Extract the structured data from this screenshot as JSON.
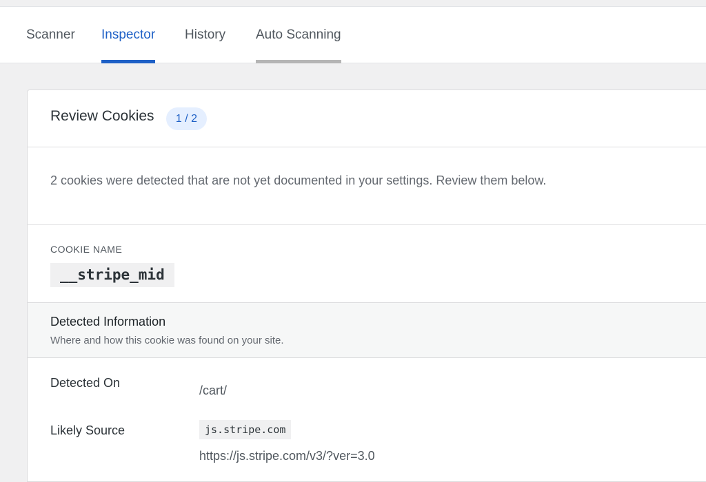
{
  "tabs": [
    {
      "label": "Scanner"
    },
    {
      "label": "Inspector"
    },
    {
      "label": "History"
    },
    {
      "label": "Auto Scanning"
    }
  ],
  "review": {
    "title": "Review Cookies",
    "count": "1 / 2",
    "notice": "2 cookies were detected that are not yet documented in your settings. Review them below."
  },
  "cookie": {
    "label": "COOKIE NAME",
    "name": "__stripe_mid"
  },
  "detected": {
    "title": "Detected Information",
    "subtitle": "Where and how this cookie was found on your site.",
    "detected_on_label": "Detected On",
    "detected_on_value": "/cart/",
    "source_label": "Likely Source",
    "source_domain": "js.stripe.com",
    "source_url": "https://js.stripe.com/v3/?ver=3.0"
  },
  "colors": {
    "accent": "#1e60c6",
    "badge_bg": "#e5efff",
    "page_bg": "#f0f0f1"
  }
}
